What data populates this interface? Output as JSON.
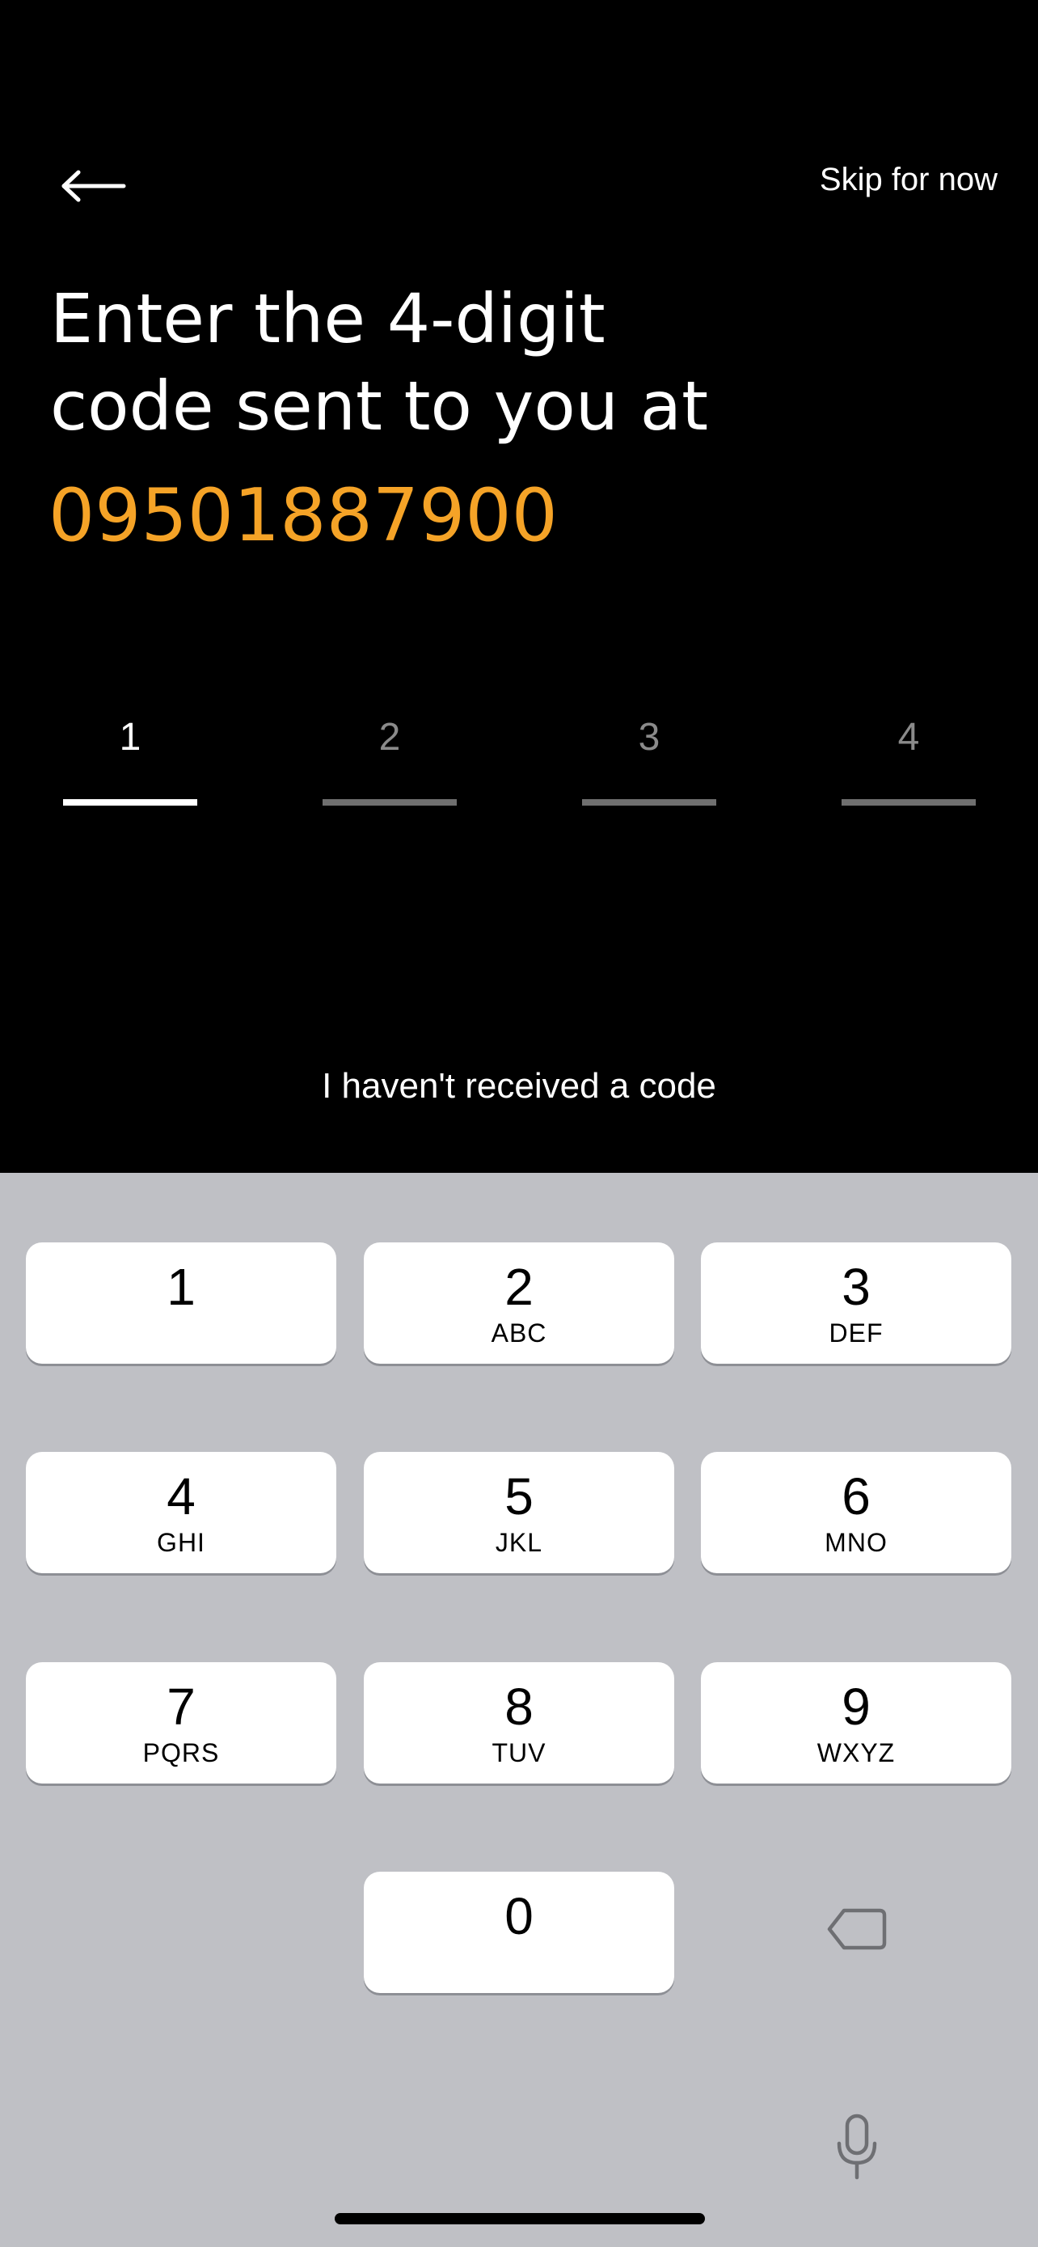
{
  "header": {
    "back_icon": "arrow-left-icon",
    "skip_label": "Skip for now"
  },
  "prompt": {
    "line1": "Enter the 4-digit",
    "line2": "code sent to you at",
    "phone_number": "09501887900",
    "phone_color": "#F5A327"
  },
  "otp": {
    "slots": [
      {
        "placeholder": "1",
        "active": true
      },
      {
        "placeholder": "2",
        "active": false
      },
      {
        "placeholder": "3",
        "active": false
      },
      {
        "placeholder": "4",
        "active": false
      }
    ]
  },
  "resend_label": "I haven't received a code",
  "keypad": {
    "keys": [
      {
        "num": "1",
        "letters": ""
      },
      {
        "num": "2",
        "letters": "ABC"
      },
      {
        "num": "3",
        "letters": "DEF"
      },
      {
        "num": "4",
        "letters": "GHI"
      },
      {
        "num": "5",
        "letters": "JKL"
      },
      {
        "num": "6",
        "letters": "MNO"
      },
      {
        "num": "7",
        "letters": "PQRS"
      },
      {
        "num": "8",
        "letters": "TUV"
      },
      {
        "num": "9",
        "letters": "WXYZ"
      },
      {
        "num": "0",
        "letters": ""
      }
    ],
    "delete_icon": "delete-backspace-icon",
    "mic_icon": "microphone-icon",
    "background_color": "#BFC0C5"
  }
}
